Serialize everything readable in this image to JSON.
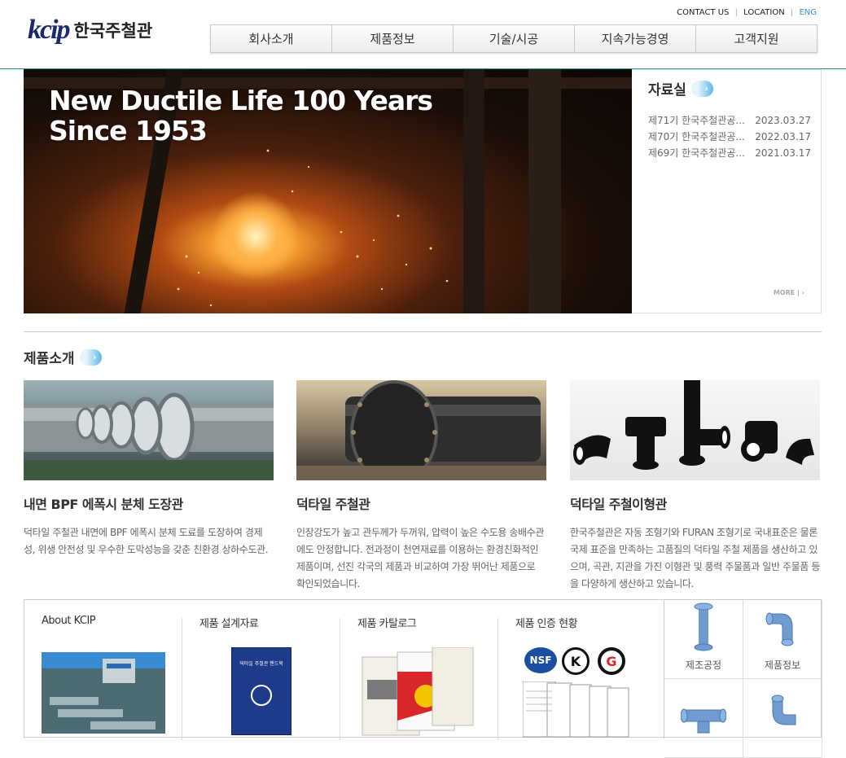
{
  "brand": {
    "logo_mark": "kcip",
    "logo_text": "한국주철관"
  },
  "util_nav": {
    "contact": "CONTACT US",
    "location": "LOCATION",
    "eng": "ENG",
    "sep": "|"
  },
  "gnb": [
    "회사소개",
    "제품정보",
    "기술/시공",
    "지속가능경영",
    "고객지원"
  ],
  "hero": {
    "line1": "New Ductile Life 100 Years",
    "line2": "Since 1953"
  },
  "notice": {
    "title": "자료실",
    "arrow": "›",
    "items": [
      {
        "title": "제71기 한국주철관공...",
        "date": "2023.03.27"
      },
      {
        "title": "제70기 한국주철관공...",
        "date": "2022.03.17"
      },
      {
        "title": "제69기 한국주철관공...",
        "date": "2021.03.17"
      }
    ],
    "more": "MORE | ›"
  },
  "products_section": {
    "title": "제품소개",
    "arrow": "›"
  },
  "products": [
    {
      "title": "내면 BPF 에폭시 분체 도장관",
      "desc": "덕타일 주철관 내면에 BPF 에폭시 분체 도료를 도장하여 경제성, 위생 안전성 및 우수한 도막성능을 갖춘 친환경 상하수도관."
    },
    {
      "title": "덕타일 주철관",
      "desc": "인장강도가 높고 관두께가 두꺼워, 압력이 높은 수도용 송배수관에도 안정합니다. 전과정이 천연재료를 이용하는 환경친화적인 제품이며, 선진 각국의 제품과 비교하여 가장 뛰어난 제품으로 확인되었습니다."
    },
    {
      "title": "덕타일 주철이형관",
      "desc": "한국주철관은 자동 조형기와 FURAN 조형기로 국내표준은 물론 국제 표준을 만족하는 고품질의 덕타일 주철 제품을 생산하고 있으며, 곡관, 지관을 가진 이형관 및 풍력 주물품과 일반 주물품 등을 다양하게 생산하고 있습니다."
    }
  ],
  "bottom": {
    "cols": [
      "About KCIP",
      "제품 설계자료",
      "제품 카탈로그",
      "제품 인증 현황"
    ],
    "quick": [
      "제조공정",
      "제품정보"
    ],
    "cover_title": "덕타일 주철관 핸드북",
    "cert_labels": [
      "NSF",
      "K",
      "G"
    ]
  }
}
